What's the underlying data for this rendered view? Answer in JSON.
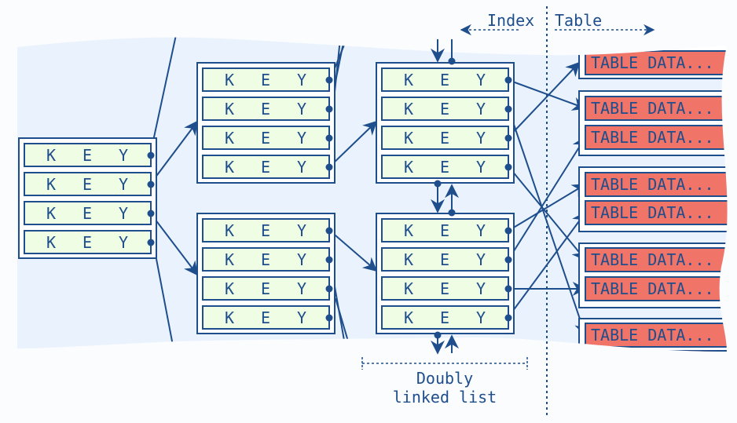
{
  "header": {
    "index_label": "Index",
    "table_label": "Table"
  },
  "footer": {
    "line1": "Doubly",
    "line2": "linked list"
  },
  "key_letters": [
    "K",
    "E",
    "Y"
  ],
  "table_row_label": "TABLE DATA...",
  "colors": {
    "line": "#1f4e8c",
    "key_fill": "#eefde4",
    "table_fill": "#f07468",
    "region": "#eaf3fd",
    "page": "#fafcfe"
  }
}
